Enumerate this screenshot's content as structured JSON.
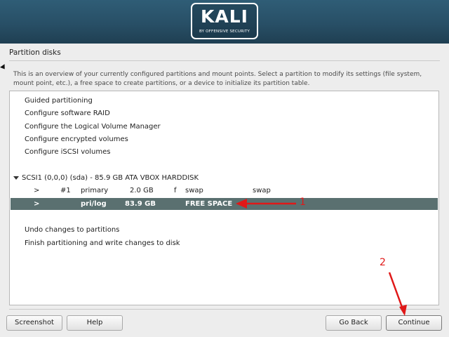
{
  "banner": {
    "logo_text": "KALI",
    "logo_subtext": "BY OFFENSIVE SECURITY"
  },
  "step_title": "Partition disks",
  "description": "This is an overview of your currently configured partitions and mount points. Select a partition to modify its settings (file system, mount point, etc.), a free space to create partitions, or a device to initialize its partition table.",
  "menu_top": [
    {
      "label": "Guided partitioning"
    },
    {
      "label": "Configure software RAID"
    },
    {
      "label": "Configure the Logical Volume Manager"
    },
    {
      "label": "Configure encrypted volumes"
    },
    {
      "label": "Configure iSCSI volumes"
    }
  ],
  "disk": {
    "label": "SCSI1 (0,0,0) (sda) - 85.9 GB ATA VBOX HARDDISK",
    "partitions": [
      {
        "marker": ">",
        "number": "#1",
        "type": "primary",
        "size": "2.0 GB",
        "flag": "f",
        "fs": "swap",
        "mount": "swap",
        "selected": false
      },
      {
        "marker": ">",
        "number": "",
        "type": "pri/log",
        "size": "83.9 GB",
        "flag": "",
        "fs": "FREE SPACE",
        "mount": "",
        "selected": true
      }
    ]
  },
  "menu_bottom": [
    {
      "label": "Undo changes to partitions"
    },
    {
      "label": "Finish partitioning and write changes to disk"
    }
  ],
  "buttons": {
    "screenshot": "Screenshot",
    "help": "Help",
    "go_back": "Go Back",
    "continue": "Continue"
  },
  "annotations": {
    "label_1": "1",
    "label_2": "2",
    "color": "#e01818"
  },
  "colors": {
    "banner": "#284f66",
    "selected_row": "#5a7070",
    "background": "#ededed"
  }
}
